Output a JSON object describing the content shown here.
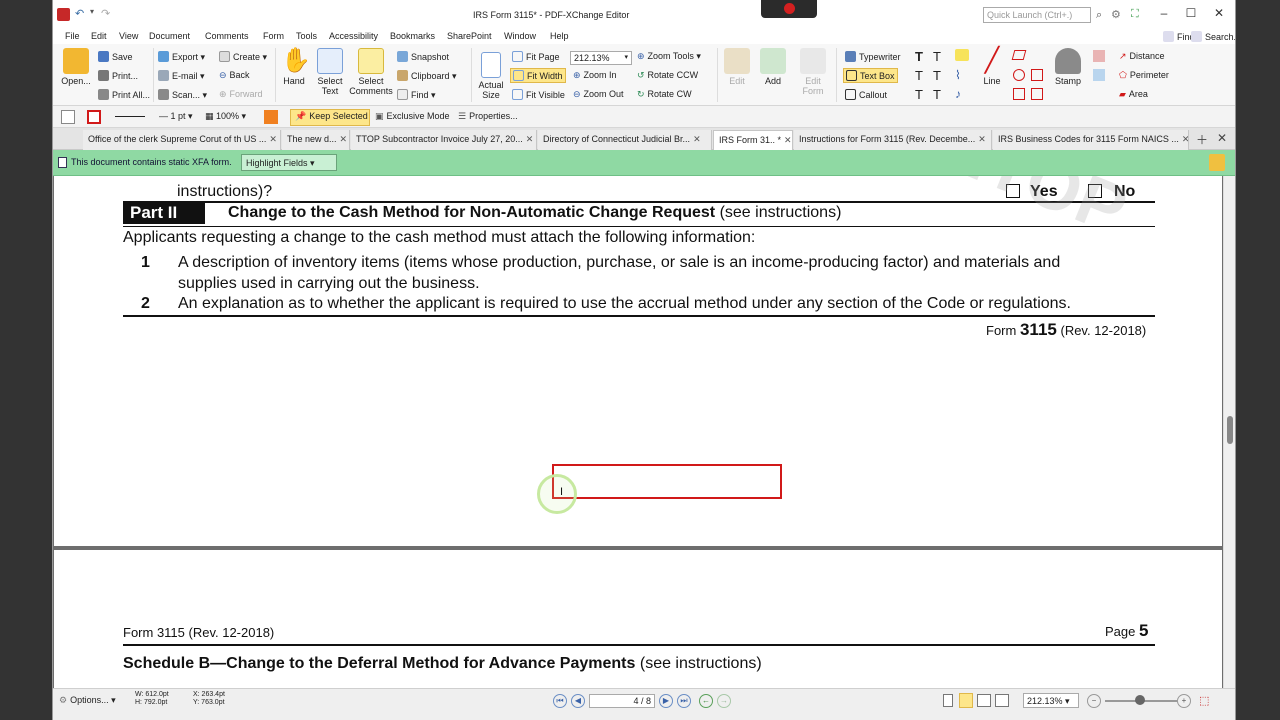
{
  "window": {
    "title": "IRS Form 3115* - PDF-XChange Editor",
    "quick_launch": "Quick Launch (Ctrl+.)"
  },
  "menu": [
    "File",
    "Edit",
    "View",
    "Document",
    "Comments",
    "Form",
    "Tools",
    "Accessibility",
    "Bookmarks",
    "SharePoint",
    "Window",
    "Help"
  ],
  "ribbon": {
    "open": "Open...",
    "save": "Save",
    "print": "Print...",
    "print_all": "Print All...",
    "export": "Export",
    "email": "E-mail",
    "scan": "Scan...",
    "create": "Create",
    "back": "Back",
    "forward": "Forward",
    "hand": "Hand",
    "select_text": "Select Text",
    "select_comments": "Select Comments",
    "snapshot": "Snapshot",
    "clipboard": "Clipboard",
    "find": "Find",
    "actual_size": "Actual Size",
    "fit_page": "Fit Page",
    "fit_width": "Fit Width",
    "fit_visible": "Fit Visible",
    "zoom_value": "212.13%",
    "zoom_tools": "Zoom Tools",
    "zoom_in": "Zoom In",
    "zoom_out": "Zoom Out",
    "rotate_ccw": "Rotate CCW",
    "rotate_cw": "Rotate CW",
    "edit": "Edit",
    "add": "Add",
    "edit_form": "Edit Form",
    "typewriter": "Typewriter",
    "text_box": "Text Box",
    "callout": "Callout",
    "line": "Line",
    "stamp": "Stamp",
    "distance": "Distance",
    "perimeter": "Perimeter",
    "area": "Area",
    "find_right": "Find...",
    "search_right": "Search..."
  },
  "propbar": {
    "line_width": "1 pt",
    "opacity": "100%",
    "keep_selected": "Keep Selected",
    "exclusive_mode": "Exclusive Mode",
    "properties": "Properties..."
  },
  "tabs": [
    {
      "label": "Office of the clerk Supreme Corut of th US ..."
    },
    {
      "label": "The new d..."
    },
    {
      "label": "TTOP Subcontractor Invoice July 27, 20..."
    },
    {
      "label": "Directory of Connecticut Judicial Br..."
    },
    {
      "label": "IRS Form 31..  *"
    },
    {
      "label": "Instructions for Form 3115 (Rev. Decembe..."
    },
    {
      "label": "IRS Business Codes for 3115 Form NAICS ..."
    }
  ],
  "xfa": {
    "message": "This document contains static XFA form.",
    "highlight_fields": "Highlight Fields"
  },
  "doc": {
    "prev_line": "instructions)?",
    "yes": "Yes",
    "no": "No",
    "part_label": "Part II",
    "part_title": "Change to the Cash Method for Non-Automatic Change Request",
    "part_see": "(see instructions)",
    "applicants": "Applicants requesting a change to the cash method must attach the following information:",
    "item1_num": "1",
    "item1_line1": "A description of inventory items (items whose production, purchase, or sale is an income-producing factor) and materials  and",
    "item1_line2": "supplies used in carrying out the business.",
    "item2_num": "2",
    "item2": "An explanation as to whether the applicant is required to use the accrual method under any section of the Code or regulations.",
    "form_prefix": "Form",
    "form_number": "3115",
    "form_rev": "(Rev. 12-2018)",
    "p2_form": "Form 3115 (Rev. 12-2018)",
    "p2_page_label": "Page",
    "p2_page_num": "5",
    "p2_schedule": "Schedule B—Change to the Deferral Method for Advance Payments",
    "p2_see": "(see instructions)"
  },
  "status": {
    "options": "Options...",
    "w": "W: 612.0pt",
    "h": "H: 792.0pt",
    "x": "X: 263.4pt",
    "y": "Y: 763.0pt",
    "page": "4",
    "page_total": "/ 8",
    "zoom": "212.13%"
  }
}
